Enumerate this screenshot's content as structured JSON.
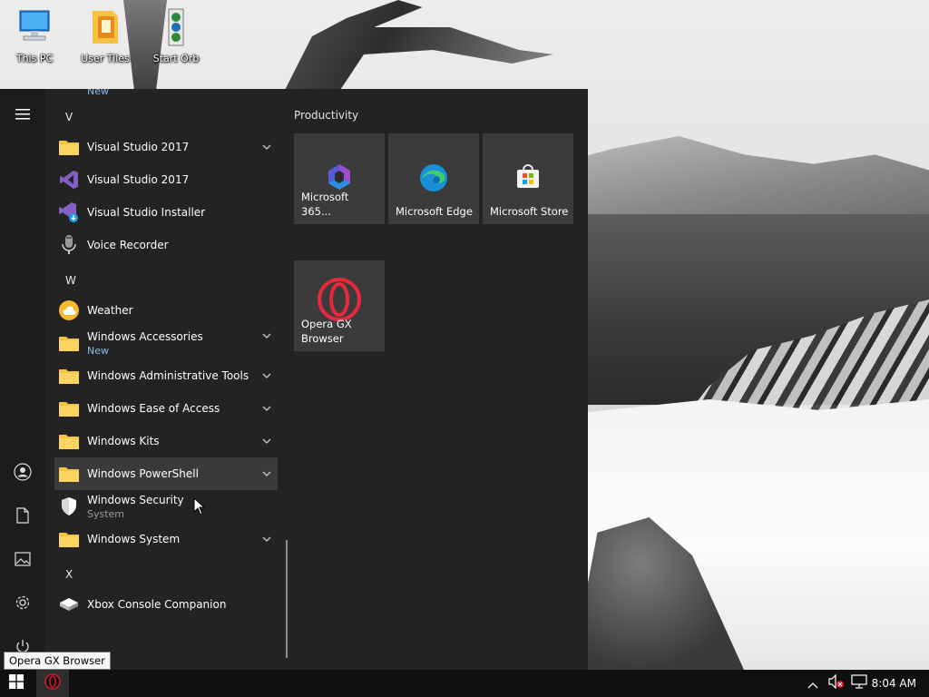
{
  "desktop": {
    "icons": [
      {
        "label": "This PC",
        "icon": "computer-icon"
      },
      {
        "label": "User Tiles",
        "icon": "folder-icon"
      },
      {
        "label": "Start Orb",
        "icon": "start-orb-icon"
      }
    ]
  },
  "start_menu": {
    "rail": [
      {
        "name": "hamburger-menu",
        "icon": "hamburger-icon"
      },
      {
        "name": "account",
        "icon": "user-icon"
      },
      {
        "name": "documents",
        "icon": "document-icon"
      },
      {
        "name": "pictures",
        "icon": "image-icon"
      },
      {
        "name": "settings",
        "icon": "gear-icon"
      },
      {
        "name": "power",
        "icon": "power-icon"
      }
    ],
    "partial_new_label": "New",
    "letters": {
      "v": "V",
      "w": "W",
      "x": "X"
    },
    "apps": [
      {
        "name": "Visual Studio 2017",
        "icon": "folder-icon",
        "expandable": true
      },
      {
        "name": "Visual Studio 2017",
        "icon": "visual-studio-icon"
      },
      {
        "name": "Visual Studio Installer",
        "icon": "visual-studio-installer-icon"
      },
      {
        "name": "Voice Recorder",
        "icon": "microphone-icon"
      },
      {
        "name": "Weather",
        "icon": "weather-icon"
      },
      {
        "name": "Windows Accessories",
        "sub": "New",
        "icon": "folder-icon",
        "expandable": true
      },
      {
        "name": "Windows Administrative Tools",
        "icon": "folder-icon",
        "expandable": true
      },
      {
        "name": "Windows Ease of Access",
        "icon": "folder-icon",
        "expandable": true
      },
      {
        "name": "Windows Kits",
        "icon": "folder-icon",
        "expandable": true
      },
      {
        "name": "Windows PowerShell",
        "icon": "folder-icon",
        "expandable": true,
        "highlighted": true
      },
      {
        "name": "Windows Security",
        "sub": "System",
        "icon": "shield-icon"
      },
      {
        "name": "Windows System",
        "icon": "folder-icon",
        "expandable": true
      },
      {
        "name": "Xbox Console Companion",
        "icon": "xbox-console-icon"
      }
    ],
    "tiles": {
      "group_title": "Productivity",
      "items": [
        {
          "label": "Microsoft 365...",
          "icon": "microsoft-365-icon"
        },
        {
          "label": "Microsoft Edge",
          "icon": "edge-icon"
        },
        {
          "label": "Microsoft Store",
          "icon": "store-icon"
        },
        {
          "label": "Opera GX Browser",
          "icon": "opera-gx-icon"
        }
      ]
    }
  },
  "tooltip": {
    "text": "Opera GX Browser"
  },
  "taskbar": {
    "start_icon": "windows-logo-icon",
    "pinned": [
      {
        "icon": "opera-gx-icon"
      }
    ],
    "tray": {
      "chevron_icon": "chevron-up-icon",
      "volume_icon": "volume-muted-icon",
      "network_icon": "network-icon",
      "clock": "8:04 AM"
    }
  },
  "colors": {
    "menu_bg": "#232323",
    "rail_bg": "#1c1c1c",
    "tile_bg": "#3b3b3b",
    "highlight_bg": "#3a3a3a",
    "taskbar_bg": "#101010",
    "new_badge": "#8fb8e8",
    "opera_red": "#e8283c",
    "folder_yellow": "#f5c242"
  }
}
